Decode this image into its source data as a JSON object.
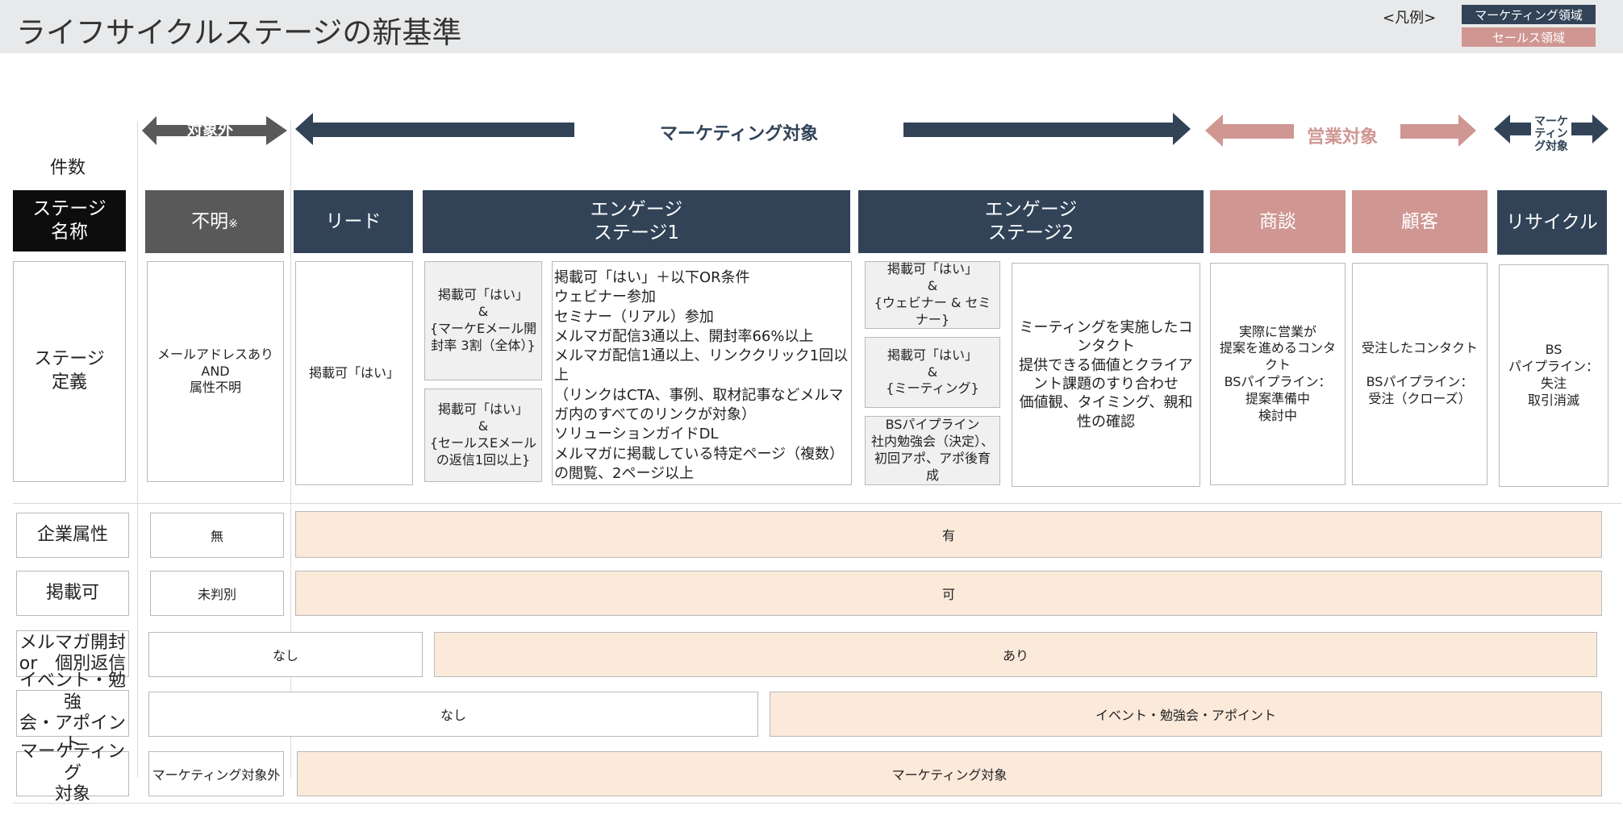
{
  "title": "ライフサイクルステージの新基準",
  "legend": {
    "label": "<凡例>",
    "marketing": "マーケティング領域",
    "sales": "セールス領域"
  },
  "arrows": {
    "out_of_scope": "対象外",
    "marketing": "マーケティング対象",
    "sales": "営業対象",
    "marketing2": "マーケ\nティン\nグ対象"
  },
  "count_label": "件数",
  "headers": {
    "stage_name": "ステージ\n名称",
    "unknown": "不明",
    "unknown_mark": "※",
    "lead": "リード",
    "engage1": "エンゲージ\nステージ1",
    "engage2": "エンゲージ\nステージ2",
    "deal": "商談",
    "customer": "顧客",
    "recycle": "リサイクル"
  },
  "definitions": {
    "label": "ステージ\n定義",
    "unknown": "メールアドレスあり\nAND\n属性不明",
    "lead": "掲載可「はい」",
    "e1_a": "掲載可「はい」\n&\n{マーケEメール開封率 3割（全体）}",
    "e1_b": "掲載可「はい」\n&\n{セールスEメールの返信1回以上}",
    "e1_c": "掲載可「はい」＋以下OR条件\nウェビナー参加\nセミナー（リアル）参加\nメルマガ配信3通以上、開封率66%以上\nメルマガ配信1通以上、リンククリック1回以上\n（リンクはCTA、事例、取材記事などメルマガ内のすべてのリンクが対象）\nソリューションガイドDL\nメルマガに掲載している特定ページ（複数）の閲覧、2ページ以上",
    "e2_a": "掲載可「はい」\n&\n{ウェビナー & セミナー}",
    "e2_b": "掲載可「はい」\n&\n{ミーティング}",
    "e2_c": "BSパイプライン\n社内勉強会（決定）、初回アポ、アポ後育成",
    "e2_d": "ミーティングを実施したコンタクト\n提供できる価値とクライアント課題のすり合わせ\n価値観、タイミング、親和性の確認",
    "deal": "実際に営業が\n提案を進めるコンタクト\nBSパイプライン：\n提案準備中\n検討中",
    "customer": "受注したコンタクト\n\nBSパイプライン：\n受注（クローズ）",
    "recycle": "BS\nパイプライン：\n失注\n取引消滅"
  },
  "attributes": [
    {
      "label": "企業属性",
      "left": "無",
      "right": "有"
    },
    {
      "label": "掲載可",
      "left": "未判別",
      "right": "可"
    },
    {
      "label": "メルマガ開封\nor　個別返信",
      "left": "なし",
      "right": "あり"
    },
    {
      "label": "イベント・勉強\n会・アポイント",
      "left": "なし",
      "right": "イベント・勉強会・アポイント"
    },
    {
      "label": "マーケティング\n対象",
      "left": "マーケティング対象外",
      "right": "マーケティング対象"
    }
  ],
  "colors": {
    "navy": "#324358",
    "pink": "#cf9692",
    "gray_header": "#595959",
    "black_header": "#0d0d0d",
    "peach": "#fbe9da"
  }
}
